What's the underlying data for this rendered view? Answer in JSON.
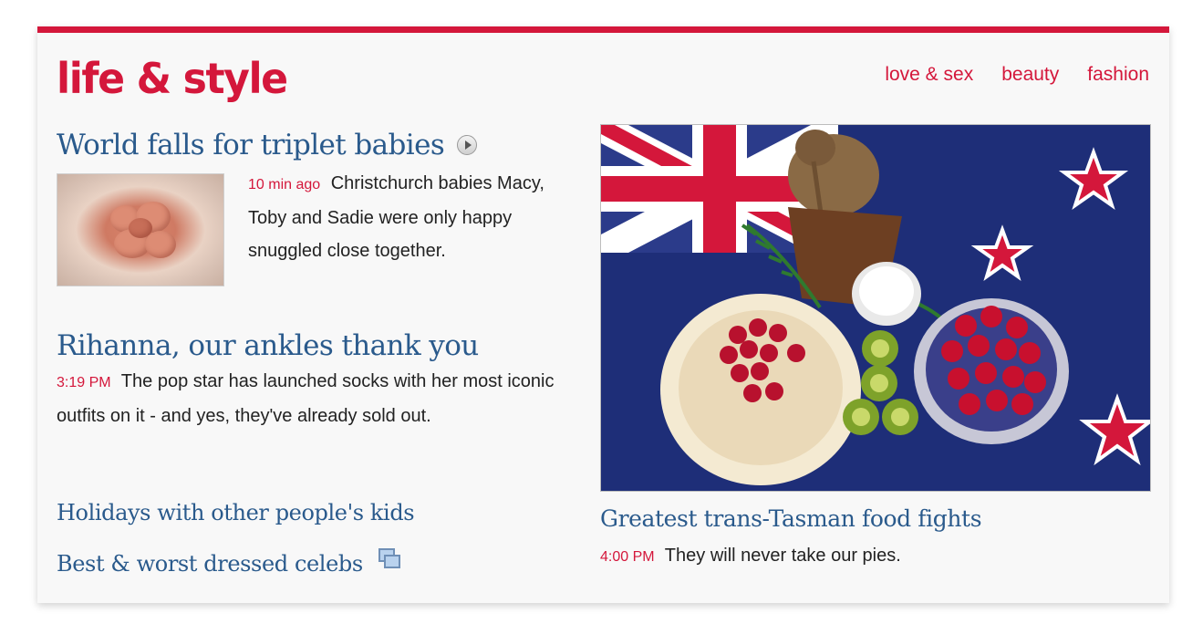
{
  "section": {
    "title": "life & style",
    "accent_color": "#d4173b",
    "link_color": "#2a5a8c"
  },
  "nav": {
    "items": [
      {
        "label": "love & sex"
      },
      {
        "label": "beauty"
      },
      {
        "label": "fashion"
      }
    ]
  },
  "stories": [
    {
      "headline": "World falls for triplet babies",
      "icon": "video-play-icon",
      "time": "10 min ago",
      "summary": "Christchurch babies Macy, Toby and Sadie were only happy snuggled close together."
    },
    {
      "headline": "Rihanna, our ankles thank you",
      "time": "3:19 PM",
      "summary": "The pop star has launched socks with her most iconic outfits on it - and yes, they've already sold out."
    },
    {
      "headline": "Holidays with other people's kids"
    },
    {
      "headline": "Best & worst dressed celebs",
      "icon": "photo-gallery-icon"
    }
  ],
  "feature": {
    "headline": "Greatest trans-Tasman food fights",
    "time": "4:00 PM",
    "summary": "They will never take our pies."
  }
}
